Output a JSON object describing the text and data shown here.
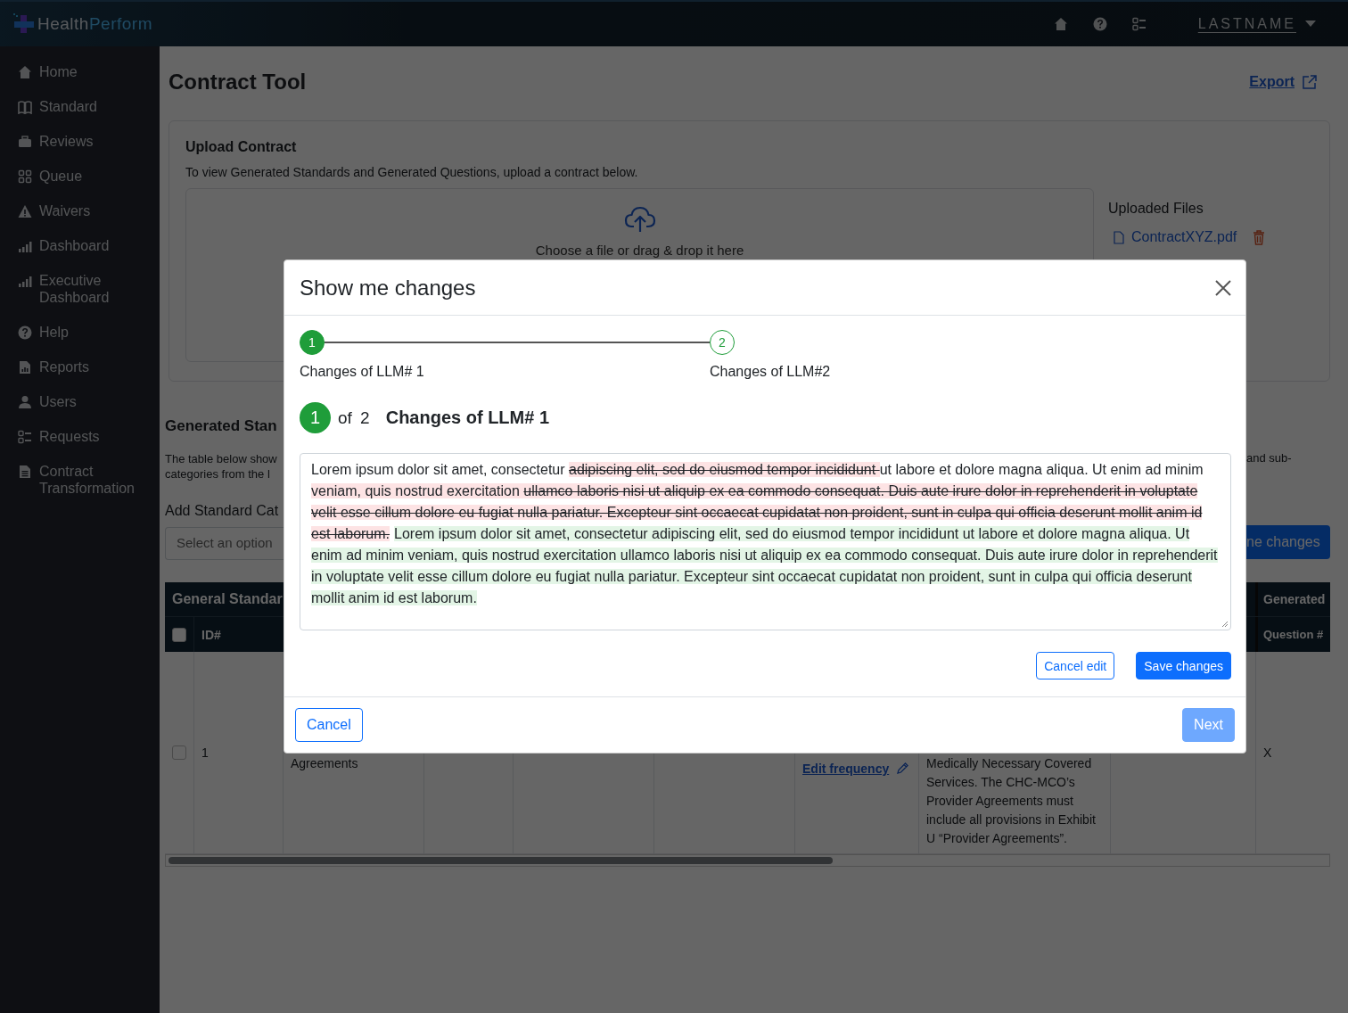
{
  "header": {
    "logo": {
      "first": "Health",
      "second": "Perform"
    },
    "user_menu": {
      "label": "LASTNAME"
    }
  },
  "sidebar": {
    "items": [
      {
        "label": "Home"
      },
      {
        "label": "Standard"
      },
      {
        "label": "Reviews"
      },
      {
        "label": "Queue"
      },
      {
        "label": "Waivers"
      },
      {
        "label": "Dashboard"
      },
      {
        "label": "Executive Dashboard"
      },
      {
        "label": "Help"
      },
      {
        "label": "Reports"
      },
      {
        "label": "Users"
      },
      {
        "label": "Requests"
      },
      {
        "label": "Contract Transformation"
      }
    ]
  },
  "page": {
    "title": "Contract Tool",
    "export_link": "Export"
  },
  "upload": {
    "title": "Upload Contract",
    "description": "To view Generated Standards and Generated Questions, upload a contract below.",
    "dropzone_text": "Choose a file or drag & drop it here",
    "uploaded_title": "Uploaded Files",
    "files": [
      {
        "name": "ContractXYZ.pdf"
      }
    ]
  },
  "generated": {
    "title": "Generated Stan",
    "description_lines": [
      "The table below show",
      "categories from the l"
    ],
    "description_right": "and sub-",
    "category_label": "Add Standard Cat",
    "select": {
      "placeholder": "Select an option"
    },
    "button": "ne changes"
  },
  "table": {
    "group_headers": [
      "General Standar",
      "Generated"
    ],
    "select_all_checked": false,
    "columns": [
      "ID#",
      "Question #"
    ],
    "rows": [
      {
        "checked": false,
        "id": "1",
        "column_3": "Agreements",
        "link": "Edit frequency",
        "column_8": "Medically Necessary Covered Services. The CHC-MCO’s Provider Agreements must include all provisions in Exhibit U “Provider Agreements”.",
        "column_10": "X"
      }
    ]
  },
  "modal": {
    "title": "Show me changes",
    "steps": [
      {
        "number": "1",
        "label": "Changes of LLM# 1",
        "selected": true
      },
      {
        "number": "2",
        "label": "Changes of LLM#2",
        "selected": false
      }
    ],
    "counter": {
      "current": "1",
      "total": "of 2",
      "heading": "Changes of LLM# 1"
    },
    "segments": [
      {
        "kind": "plain",
        "text": "Lorem ipsum dolor sit amet, consectetur "
      },
      {
        "kind": "deleted",
        "text": "adipiscing elit, sed do eiusmod tempor incididunt "
      },
      {
        "kind": "plain",
        "text": "ut labore et dolore magna aliqua. Ut enim ad minim "
      },
      {
        "kind": "changed",
        "text": "veniam, quis nostrud exercitation "
      },
      {
        "kind": "deleted",
        "text": "ullamco laboris nisi ut aliquip ex ea commodo consequat. Duis aute irure dolor in reprehenderit in voluptate velit esse cillum dolore eu fugiat nulla pariatur. Excepteur sint occaecat cupidatat non proident, sunt in culpa qui officia deserunt mollit anim id est laborum."
      },
      {
        "kind": "inserted",
        "text": "Lorem ipsum dolor sit amet, consectetur adipiscing elit, sed do eiusmod tempor incididunt ut labore et dolore magna aliqua. Ut enim ad minim veniam, quis nostrud exercitation ullamco laboris nisi ut aliquip ex ea commodo consequat. Duis aute irure dolor in reprehenderit in voluptate velit esse cillum dolore eu fugiat nulla pariatur. Excepteur sint occaecat cupidatat non proident, sunt in culpa qui officia deserunt mollit anim id est laborum. "
      }
    ],
    "edit_buttons": [
      {
        "label": "Cancel edit",
        "kind": "outline",
        "disabled": false
      },
      {
        "label": "Save changes",
        "kind": "primary",
        "disabled": false
      }
    ],
    "footer_buttons": [
      {
        "label": "Cancel",
        "kind": "outline",
        "disabled": false
      },
      {
        "label": "Next",
        "kind": "primary",
        "disabled": true
      }
    ]
  }
}
